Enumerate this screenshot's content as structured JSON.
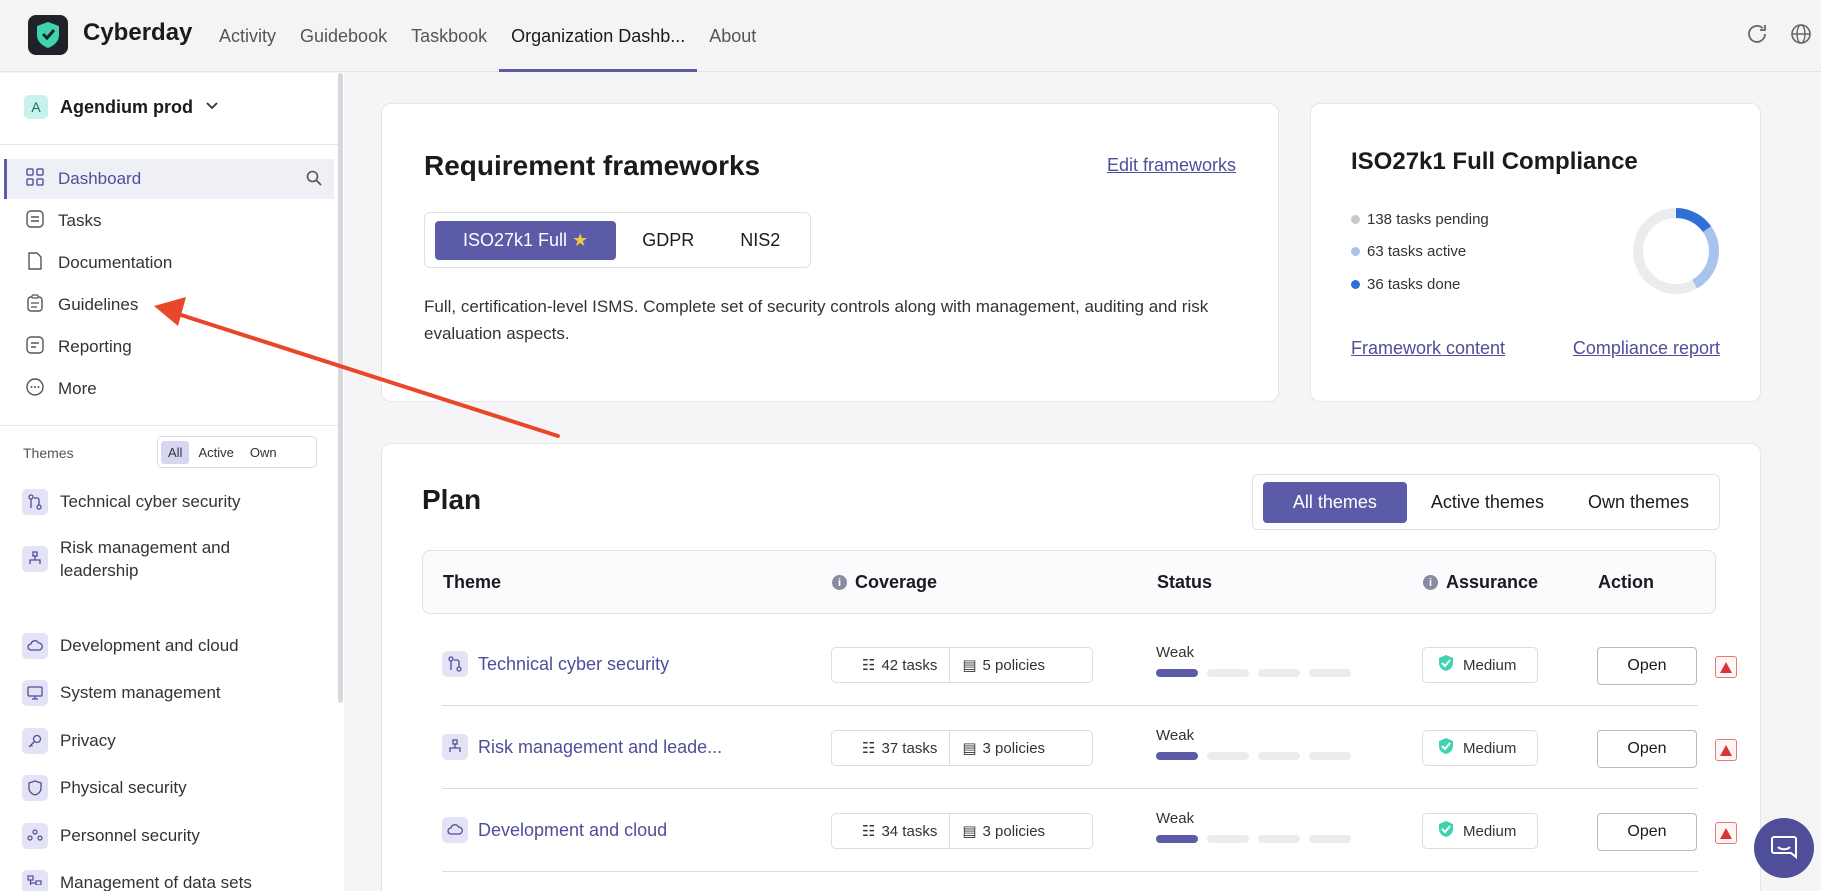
{
  "app": {
    "brand": "Cyberday"
  },
  "topnav": [
    {
      "label": "Activity",
      "active": false
    },
    {
      "label": "Guidebook",
      "active": false
    },
    {
      "label": "Taskbook",
      "active": false
    },
    {
      "label": "Organization Dashb...",
      "active": true
    },
    {
      "label": "About",
      "active": false
    }
  ],
  "sidebar": {
    "org_badge": "A",
    "org_name": "Agendium prod",
    "items": [
      {
        "label": "Dashboard",
        "icon": "grid-icon",
        "active": true
      },
      {
        "label": "Tasks",
        "icon": "tasks-icon"
      },
      {
        "label": "Documentation",
        "icon": "document-icon"
      },
      {
        "label": "Guidelines",
        "icon": "clipboard-icon"
      },
      {
        "label": "Reporting",
        "icon": "report-icon"
      },
      {
        "label": "More",
        "icon": "more-icon"
      }
    ],
    "themes_label": "Themes",
    "themes_filter": [
      "All",
      "Active",
      "Own"
    ],
    "themes_filter_selected": "All",
    "themes": [
      "Technical cyber security",
      "Risk management and leadership",
      "Development and cloud",
      "System management",
      "Privacy",
      "Physical security",
      "Personnel security",
      "Management of data sets"
    ]
  },
  "frameworks": {
    "title": "Requirement frameworks",
    "edit_link": "Edit frameworks",
    "tabs": [
      "ISO27k1 Full",
      "GDPR",
      "NIS2"
    ],
    "selected": "ISO27k1 Full",
    "description": "Full, certification-level ISMS. Complete set of security controls along with management, auditing and risk evaluation aspects."
  },
  "compliance": {
    "title": "ISO27k1 Full Compliance",
    "pending": "138 tasks pending",
    "active": "63 tasks active",
    "done": "36 tasks done",
    "counts": {
      "pending": 138,
      "active": 63,
      "done": 36
    },
    "colors": {
      "pending": "#c7c7cc",
      "active": "#a8c4ee",
      "done": "#2f6fd6"
    },
    "framework_link": "Framework content",
    "report_link": "Compliance report"
  },
  "plan": {
    "title": "Plan",
    "filters": [
      "All themes",
      "Active themes",
      "Own themes"
    ],
    "selected_filter": "All themes",
    "columns": {
      "theme": "Theme",
      "coverage": "Coverage",
      "status": "Status",
      "assurance": "Assurance",
      "action": "Action"
    },
    "rows": [
      {
        "theme": "Technical cyber security",
        "tasks": "42 tasks",
        "policies": "5 policies",
        "status": "Weak",
        "status_level": 1,
        "assurance": "Medium",
        "action": "Open"
      },
      {
        "theme": "Risk management and leade...",
        "tasks": "37 tasks",
        "policies": "3 policies",
        "status": "Weak",
        "status_level": 1,
        "assurance": "Medium",
        "action": "Open"
      },
      {
        "theme": "Development and cloud",
        "tasks": "34 tasks",
        "policies": "3 policies",
        "status": "Weak",
        "status_level": 1,
        "assurance": "Medium",
        "action": "Open"
      }
    ]
  }
}
